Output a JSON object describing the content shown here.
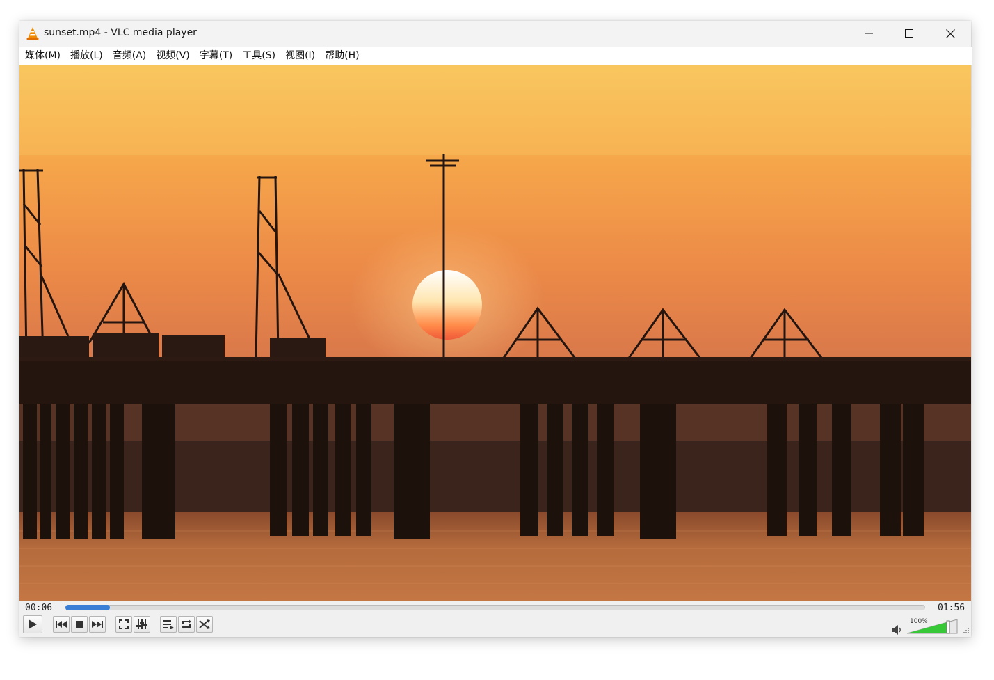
{
  "window": {
    "title": "sunset.mp4 - VLC media player",
    "icon": "vlc-cone-icon"
  },
  "menu": [
    {
      "label": "媒体(M)"
    },
    {
      "label": "播放(L)"
    },
    {
      "label": "音频(A)"
    },
    {
      "label": "视频(V)"
    },
    {
      "label": "字幕(T)"
    },
    {
      "label": "工具(S)"
    },
    {
      "label": "视图(I)"
    },
    {
      "label": "帮助(H)"
    }
  ],
  "playback": {
    "elapsed": "00:06",
    "total": "01:56",
    "progress_fraction": 0.052
  },
  "volume": {
    "label": "100%",
    "level_fraction": 0.82
  },
  "colors": {
    "seek_fill": "#3a7fd5",
    "volume_fill": "#37c837"
  },
  "icons": [
    "play-icon",
    "previous-icon",
    "stop-icon",
    "next-icon",
    "fullscreen-icon",
    "extended-settings-icon",
    "playlist-icon",
    "loop-icon",
    "shuffle-icon",
    "speaker-icon"
  ]
}
